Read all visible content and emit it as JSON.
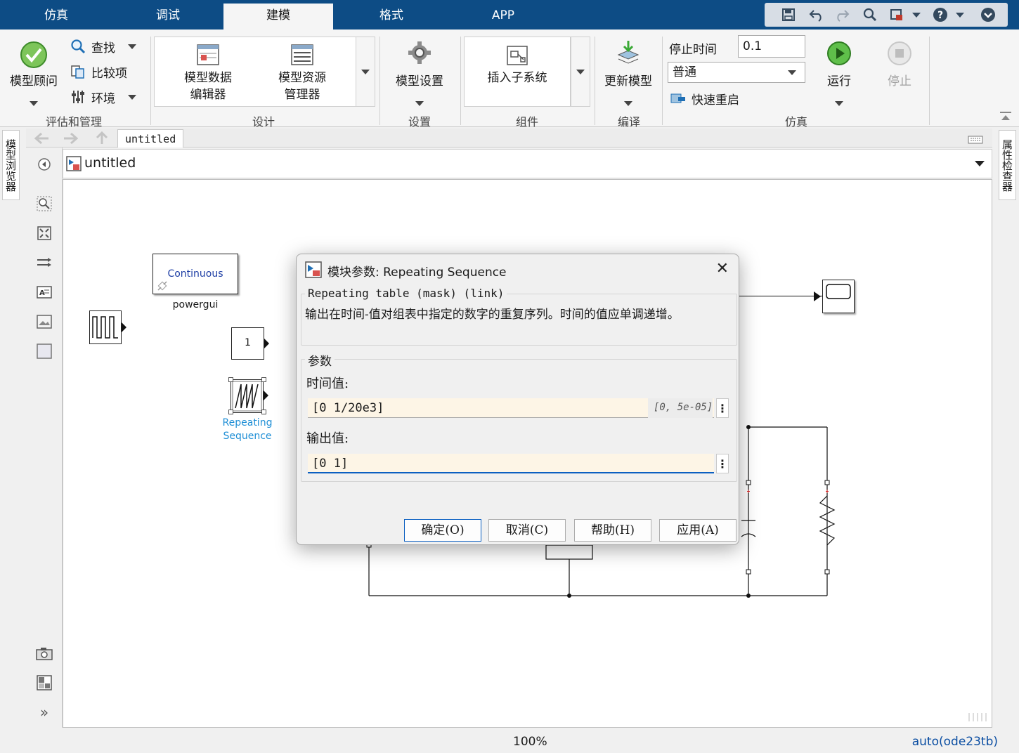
{
  "tabs": [
    "仿真",
    "调试",
    "建模",
    "格式",
    "APP"
  ],
  "active_tab": "建模",
  "ribbon": {
    "model_advisor": "模型顾问",
    "find": "查找",
    "compare": "比较项",
    "environment": "环境",
    "group_evaluate": "评估和管理",
    "data_editor_line1": "模型数据",
    "data_editor_line2": "编辑器",
    "explorer_line1": "模型资源",
    "explorer_line2": "管理器",
    "group_design": "设计",
    "model_settings": "模型设置",
    "group_setup": "设置",
    "insert_subsystem": "插入子系统",
    "group_component": "组件",
    "update_model": "更新模型",
    "group_compile": "编译",
    "stop_time_label": "停止时间",
    "stop_time_value": "0.1",
    "sim_mode": "普通",
    "fast_restart": "快速重启",
    "run": "运行",
    "stop": "停止",
    "group_simulation": "仿真"
  },
  "left_panel_tab": "模型浏览器",
  "right_panel_tab": "属性检查器",
  "doc_tab": "untitled",
  "address": "untitled",
  "canvas": {
    "powergui_label": "Continuous",
    "powergui_name": "powergui",
    "constant_value": "1",
    "repeating_name_line1": "Repeating",
    "repeating_name_line2": "Sequence"
  },
  "dialog": {
    "title": "模块参数: Repeating Sequence",
    "section_header": "Repeating table (mask) (link)",
    "description": "输出在时间-值对组表中指定的数字的重复序列。时间的值应单调递增。",
    "params_header": "参数",
    "time_label": "时间值:",
    "time_value": "[0 1/20e3]",
    "time_hint": "[0, 5e-05]",
    "output_label": "输出值:",
    "output_value": "[0 1]",
    "ok": "确定(O)",
    "cancel": "取消(C)",
    "help": "帮助(H)",
    "apply": "应用(A)"
  },
  "status": {
    "zoom": "100%",
    "solver": "auto(ode23tb)"
  },
  "colors": {
    "tabbar": "#0d4c85",
    "accent": "#0b5fc1",
    "input_bg": "#fdf5e6",
    "run_green": "#3aa935"
  }
}
